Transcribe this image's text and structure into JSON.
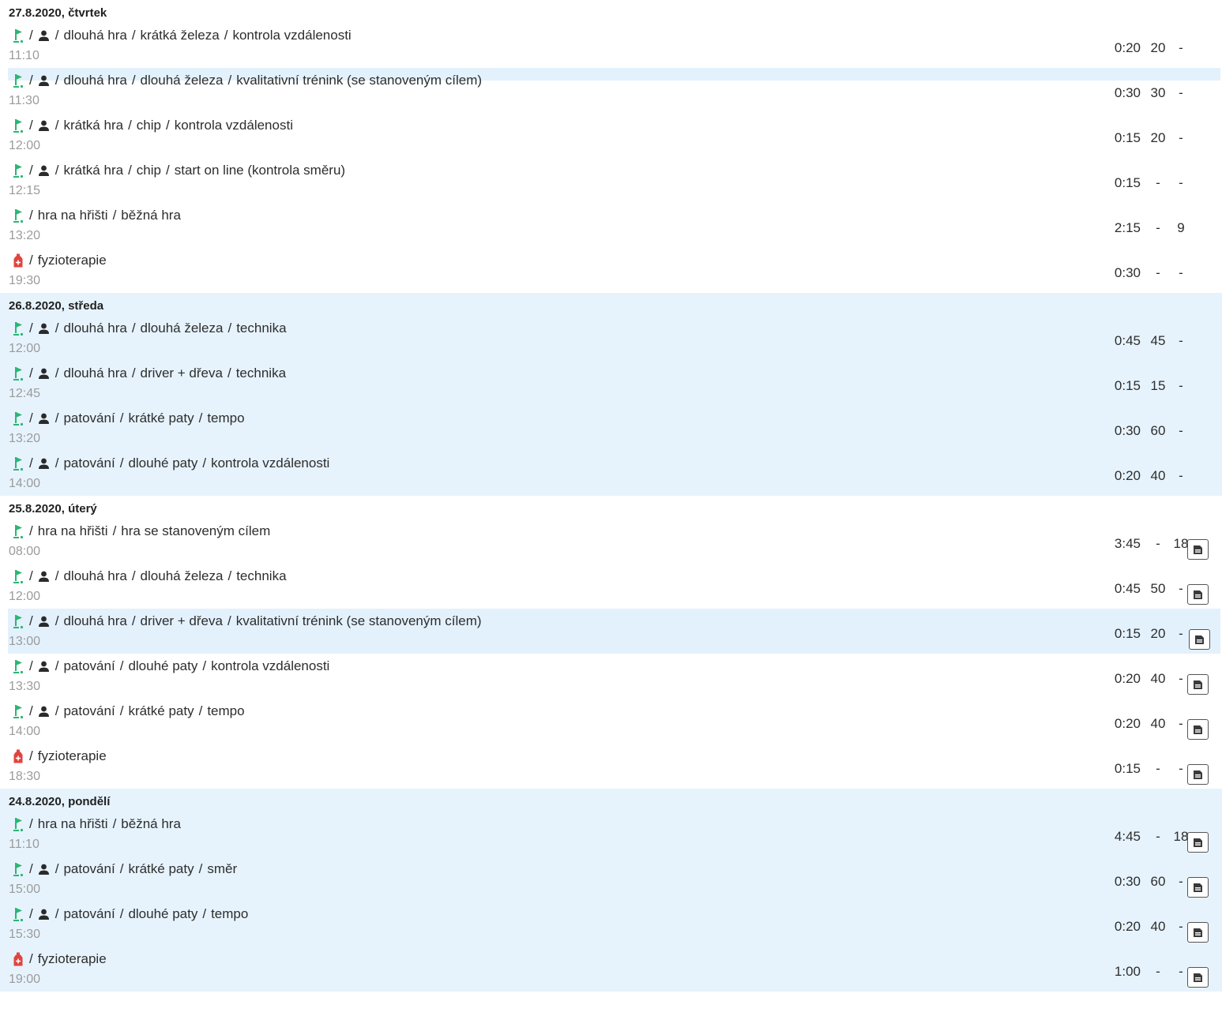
{
  "colors": {
    "accent_green": "#2bb673",
    "physio_red": "#e0443d",
    "band_blue": "#e6f3fd",
    "time_gray": "#9b9b9b"
  },
  "days": [
    {
      "date": "27.8.2020, čtvrtek",
      "band": false,
      "entries": [
        {
          "icons": [
            "golf-flag-icon",
            "person-icon"
          ],
          "path": [
            "dlouhá hra",
            "krátká železa",
            "kontrola vzdálenosti"
          ],
          "time": "11:10",
          "duration": "0:20",
          "stat1": "20",
          "stat2": "-",
          "doc": false
        },
        {
          "icons": [
            "golf-flag-icon",
            "person-icon"
          ],
          "path": [
            "dlouhá hra",
            "dlouhá železa",
            "kvalitativní trénink (se stanoveným cílem)"
          ],
          "time": "11:30",
          "duration": "0:30",
          "stat1": "30",
          "stat2": "-",
          "doc": false,
          "hl": "partial"
        },
        {
          "icons": [
            "golf-flag-icon",
            "person-icon"
          ],
          "path": [
            "krátká hra",
            "chip",
            "kontrola vzdálenosti"
          ],
          "time": "12:00",
          "duration": "0:15",
          "stat1": "20",
          "stat2": "-",
          "doc": false
        },
        {
          "icons": [
            "golf-flag-icon",
            "person-icon"
          ],
          "path": [
            "krátká hra",
            "chip",
            "start on line (kontrola směru)"
          ],
          "time": "12:15",
          "duration": "0:15",
          "stat1": "-",
          "stat2": "-",
          "doc": false
        },
        {
          "icons": [
            "golf-flag-icon"
          ],
          "path": [
            "hra na hřišti",
            "běžná hra"
          ],
          "time": "13:20",
          "duration": "2:15",
          "stat1": "-",
          "stat2": "9",
          "doc": false
        },
        {
          "icons": [
            "physio-bottle-icon"
          ],
          "path": [
            "fyzioterapie"
          ],
          "time": "19:30",
          "duration": "0:30",
          "stat1": "-",
          "stat2": "-",
          "doc": false
        }
      ]
    },
    {
      "date": "26.8.2020, středa",
      "band": true,
      "entries": [
        {
          "icons": [
            "golf-flag-icon",
            "person-icon"
          ],
          "path": [
            "dlouhá hra",
            "dlouhá železa",
            "technika"
          ],
          "time": "12:00",
          "duration": "0:45",
          "stat1": "45",
          "stat2": "-",
          "doc": false
        },
        {
          "icons": [
            "golf-flag-icon",
            "person-icon"
          ],
          "path": [
            "dlouhá hra",
            "driver + dřeva",
            "technika"
          ],
          "time": "12:45",
          "duration": "0:15",
          "stat1": "15",
          "stat2": "-",
          "doc": false
        },
        {
          "icons": [
            "golf-flag-icon",
            "person-icon"
          ],
          "path": [
            "patování",
            "krátké paty",
            "tempo"
          ],
          "time": "13:20",
          "duration": "0:30",
          "stat1": "60",
          "stat2": "-",
          "doc": false
        },
        {
          "icons": [
            "golf-flag-icon",
            "person-icon"
          ],
          "path": [
            "patování",
            "dlouhé paty",
            "kontrola vzdálenosti"
          ],
          "time": "14:00",
          "duration": "0:20",
          "stat1": "40",
          "stat2": "-",
          "doc": false
        }
      ]
    },
    {
      "date": "25.8.2020, úterý",
      "band": false,
      "entries": [
        {
          "icons": [
            "golf-flag-icon"
          ],
          "path": [
            "hra na hřišti",
            "hra se stanoveným cílem"
          ],
          "time": "08:00",
          "duration": "3:45",
          "stat1": "-",
          "stat2": "18",
          "doc": true
        },
        {
          "icons": [
            "golf-flag-icon",
            "person-icon"
          ],
          "path": [
            "dlouhá hra",
            "dlouhá železa",
            "technika"
          ],
          "time": "12:00",
          "duration": "0:45",
          "stat1": "50",
          "stat2": "-",
          "doc": true
        },
        {
          "icons": [
            "golf-flag-icon",
            "person-icon"
          ],
          "path": [
            "dlouhá hra",
            "driver + dřeva",
            "kvalitativní trénink (se stanoveným cílem)"
          ],
          "time": "13:00",
          "duration": "0:15",
          "stat1": "20",
          "stat2": "-",
          "doc": true,
          "hl": "full"
        },
        {
          "icons": [
            "golf-flag-icon",
            "person-icon"
          ],
          "path": [
            "patování",
            "dlouhé paty",
            "kontrola vzdálenosti"
          ],
          "time": "13:30",
          "duration": "0:20",
          "stat1": "40",
          "stat2": "-",
          "doc": true
        },
        {
          "icons": [
            "golf-flag-icon",
            "person-icon"
          ],
          "path": [
            "patování",
            "krátké paty",
            "tempo"
          ],
          "time": "14:00",
          "duration": "0:20",
          "stat1": "40",
          "stat2": "-",
          "doc": true
        },
        {
          "icons": [
            "physio-bottle-icon"
          ],
          "path": [
            "fyzioterapie"
          ],
          "time": "18:30",
          "duration": "0:15",
          "stat1": "-",
          "stat2": "-",
          "doc": true
        }
      ]
    },
    {
      "date": "24.8.2020, pondělí",
      "band": true,
      "entries": [
        {
          "icons": [
            "golf-flag-icon"
          ],
          "path": [
            "hra na hřišti",
            "běžná hra"
          ],
          "time": "11:10",
          "duration": "4:45",
          "stat1": "-",
          "stat2": "18",
          "doc": true
        },
        {
          "icons": [
            "golf-flag-icon",
            "person-icon"
          ],
          "path": [
            "patování",
            "krátké paty",
            "směr"
          ],
          "time": "15:00",
          "duration": "0:30",
          "stat1": "60",
          "stat2": "-",
          "doc": true
        },
        {
          "icons": [
            "golf-flag-icon",
            "person-icon"
          ],
          "path": [
            "patování",
            "dlouhé paty",
            "tempo"
          ],
          "time": "15:30",
          "duration": "0:20",
          "stat1": "40",
          "stat2": "-",
          "doc": true
        },
        {
          "icons": [
            "physio-bottle-icon"
          ],
          "path": [
            "fyzioterapie"
          ],
          "time": "19:00",
          "duration": "1:00",
          "stat1": "-",
          "stat2": "-",
          "doc": true
        }
      ]
    }
  ]
}
